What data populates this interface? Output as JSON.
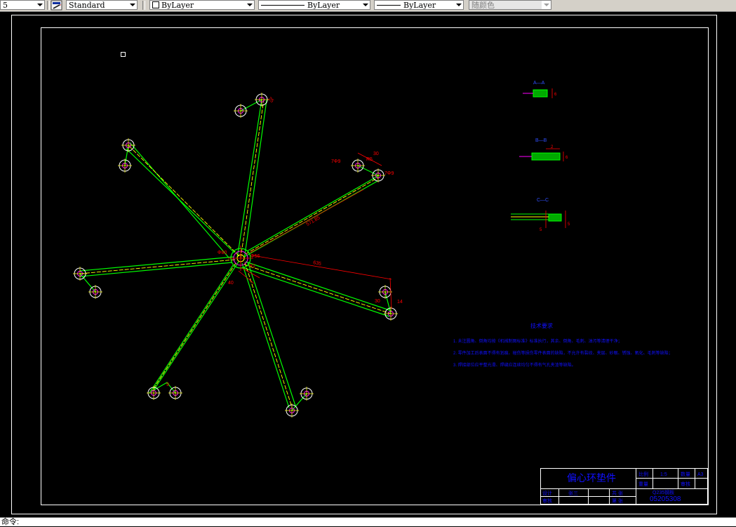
{
  "toolbar": {
    "scale_value": "5",
    "text_style": "Standard",
    "layer": "ByLayer",
    "linetype": "ByLayer",
    "lineweight": "ByLayer",
    "plot_style": "随颜色"
  },
  "drawing": {
    "colors": {
      "background": "#000000",
      "frame": "#ffffff",
      "outline": "#00ff00",
      "centerline": "#ffff00",
      "dimension": "#ff0000",
      "hole": "#ff00ff",
      "annotation": "#1010ff"
    },
    "dimensions": {
      "d1": "25",
      "d2": "R5",
      "d3": "Φ80",
      "d4": "Φ56",
      "d5": "R1",
      "d6": "40",
      "d7": "635",
      "d8": "571.85",
      "d9": "30",
      "d10": "7Φ9",
      "d11": "7Φ9",
      "d12": "14",
      "d13": "9",
      "d14": "30"
    },
    "section_labels": {
      "aa": "A—A",
      "bb": "B—B",
      "cc": "C—C"
    },
    "section_dims": {
      "aa_right": "6",
      "bb_top": "2",
      "bb_right": "6",
      "cc_a": "5",
      "cc_b": "5"
    },
    "notes": {
      "heading": "技术要求",
      "line1": "1. 未注圆角、倒角均按《机械制图标准》标准执行，其余、倒角、毛刺、油污等清理干净；",
      "line2": "2. 零件加工后表面不得有划痕、碰伤等损伤零件表面的缺陷，不允许有裂纹、夹层、砂眼、锈蚀、氧化、毛刺等缺陷；",
      "line3": "3. 焊接部位应平整光滑、焊缝应连续均匀不得有气孔夹渣等缺陷。"
    },
    "title_block": {
      "part_name": "偏心环垫件",
      "drawing_no": "05205308",
      "material": "Q235钢板",
      "scale_label": "比例",
      "scale_value": "1:5",
      "weight_label": "重量",
      "quantity_label": "数量",
      "sheet_value": "A3",
      "designer_label": "设计",
      "checker_label": "审核",
      "designer_name": "张三",
      "page1": "共 张",
      "page2": "第 张"
    }
  },
  "command_line": "命令:"
}
